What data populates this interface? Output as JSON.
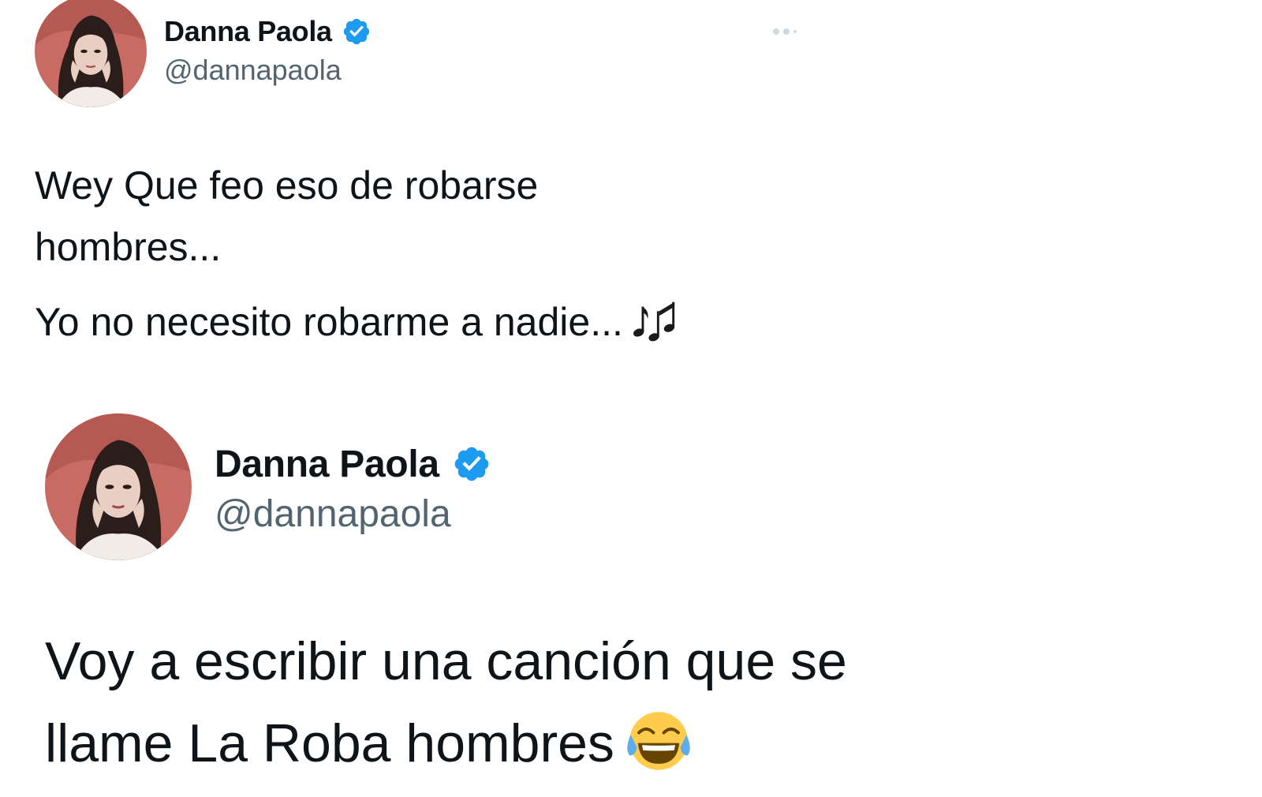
{
  "tweets": [
    {
      "user": {
        "display_name": "Danna Paola",
        "handle": "@dannapaola",
        "verified": true,
        "verified_icon": "verified-badge-icon"
      },
      "more_icon": "more-options-icon",
      "text_lines": [
        "Wey Que feo eso de robarse",
        "hombres..."
      ],
      "text_line2": "Yo no necesito robarme a nadie...",
      "emoji": "musical-notes-icon"
    },
    {
      "user": {
        "display_name": "Danna Paola",
        "handle": "@dannapaola",
        "verified": true,
        "verified_icon": "verified-badge-icon"
      },
      "text_lines": [
        "Voy a escribir una canción que se",
        "llame La Roba hombres"
      ],
      "emoji": "face-with-tears-of-joy-icon"
    }
  ],
  "colors": {
    "text": "#0f1419",
    "handle": "#536471",
    "verified_blue": "#1d9bf0",
    "avatar_background": "#c86a62"
  }
}
